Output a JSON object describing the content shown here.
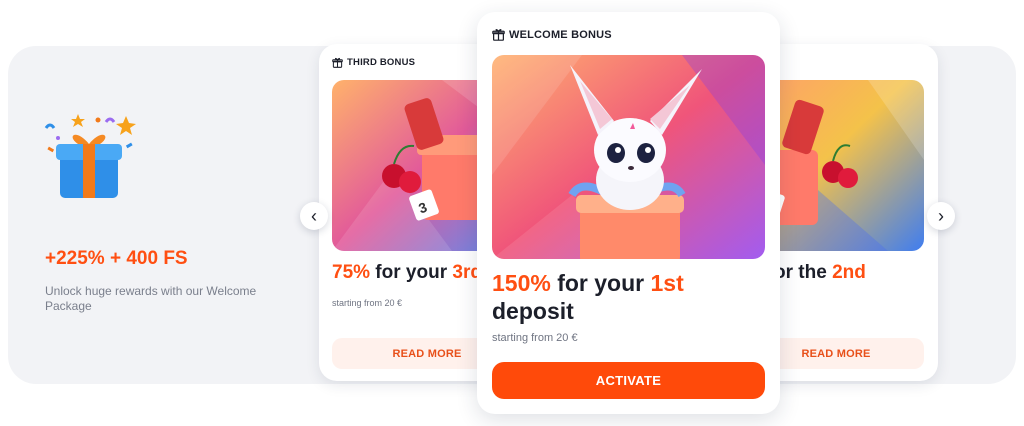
{
  "intro": {
    "amount": "+225% + 400 FS",
    "description": "Unlock huge rewards with our Welcome Package",
    "gift_icon": "gift-box-confetti-icon"
  },
  "cards": {
    "third": {
      "label": "THIRD BONUS",
      "title_percent": "75%",
      "title_text": " for your ",
      "title_accent": "3rd",
      "subtitle": "starting from 20 €",
      "button": "READ MORE"
    },
    "welcome": {
      "label": "WELCOME BONUS",
      "title_percent": "150%",
      "title_text": " for your ",
      "title_accent": "1st",
      "title_line2": "deposit",
      "subtitle": "starting from 20 €",
      "button": "ACTIVATE"
    },
    "second": {
      "title_text": "or the ",
      "title_accent": "2nd",
      "button": "READ MORE"
    }
  },
  "nav": {
    "prev": "‹",
    "next": "›"
  },
  "colors": {
    "accent": "#ff4f12",
    "button": "#ff4a0a",
    "panel": "#f2f3f6"
  }
}
